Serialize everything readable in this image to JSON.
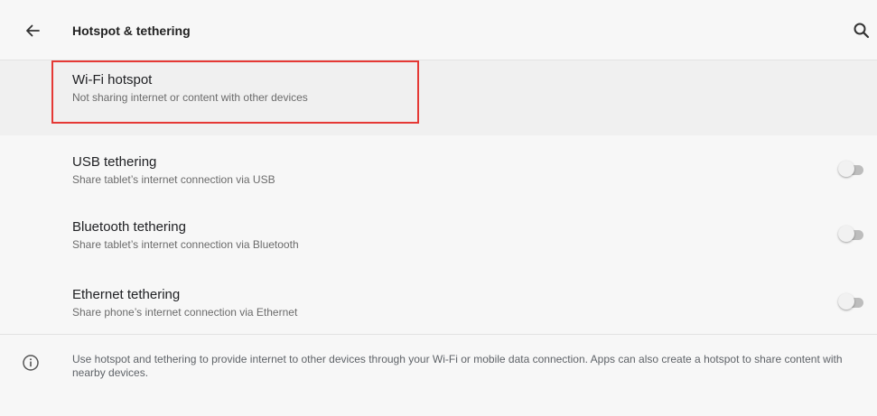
{
  "appbar": {
    "title": "Hotspot & tethering",
    "back_icon": "arrow-left-icon",
    "search_icon": "search-icon"
  },
  "hotspot": {
    "title": "Wi-Fi hotspot",
    "subtitle": "Not sharing internet or content with other devices"
  },
  "toggles": [
    {
      "title": "USB tethering",
      "subtitle": "Share tablet’s internet connection via USB",
      "enabled": false
    },
    {
      "title": "Bluetooth tethering",
      "subtitle": "Share tablet’s internet connection via Bluetooth",
      "enabled": false
    },
    {
      "title": "Ethernet tethering",
      "subtitle": "Share phone’s internet connection via Ethernet",
      "enabled": false
    }
  ],
  "footer": {
    "info_icon": "info-icon",
    "text": "Use hotspot and tethering to provide internet to other devices through your Wi-Fi or mobile data connection. Apps can also create a hotspot to share content with nearby devices."
  },
  "colors": {
    "highlight": "#e53935",
    "switch_off_track": "#bdbdbd",
    "switch_off_thumb": "#f1f1f1"
  }
}
